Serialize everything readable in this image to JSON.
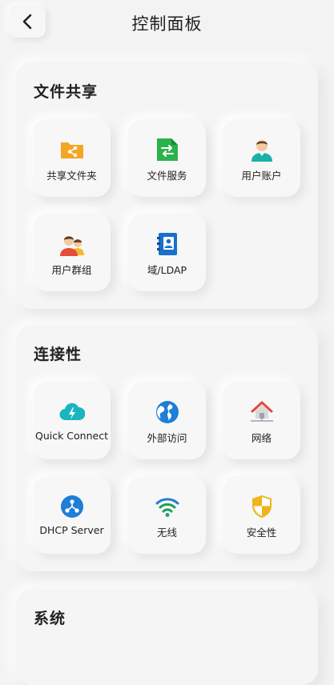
{
  "header": {
    "title": "控制面板",
    "back_icon": "chevron-left-icon"
  },
  "sections": [
    {
      "title": "文件共享",
      "items": [
        {
          "label": "共享文件夹",
          "icon": "shared-folder-icon",
          "color": "#f5a623"
        },
        {
          "label": "文件服务",
          "icon": "file-service-icon",
          "color": "#2bb24c"
        },
        {
          "label": "用户账户",
          "icon": "user-account-icon",
          "color": "#1bb0a8"
        },
        {
          "label": "用户群组",
          "icon": "user-group-icon",
          "color": "#e44d3a"
        },
        {
          "label": "域/LDAP",
          "icon": "domain-ldap-icon",
          "color": "#1a6fc9"
        }
      ]
    },
    {
      "title": "连接性",
      "items": [
        {
          "label": "Quick Connect",
          "icon": "cloud-bolt-icon",
          "color": "#1ab5c0"
        },
        {
          "label": "外部访问",
          "icon": "globe-icon",
          "color": "#1e7ed8"
        },
        {
          "label": "网络",
          "icon": "home-network-icon",
          "color": "#e04a3f"
        },
        {
          "label": "DHCP Server",
          "icon": "dhcp-icon",
          "color": "#1e7ed8"
        },
        {
          "label": "无线",
          "icon": "wifi-icon",
          "color": "#19a05a"
        },
        {
          "label": "安全性",
          "icon": "shield-icon",
          "color": "#f0b51c"
        }
      ]
    },
    {
      "title": "系统",
      "items": []
    }
  ]
}
